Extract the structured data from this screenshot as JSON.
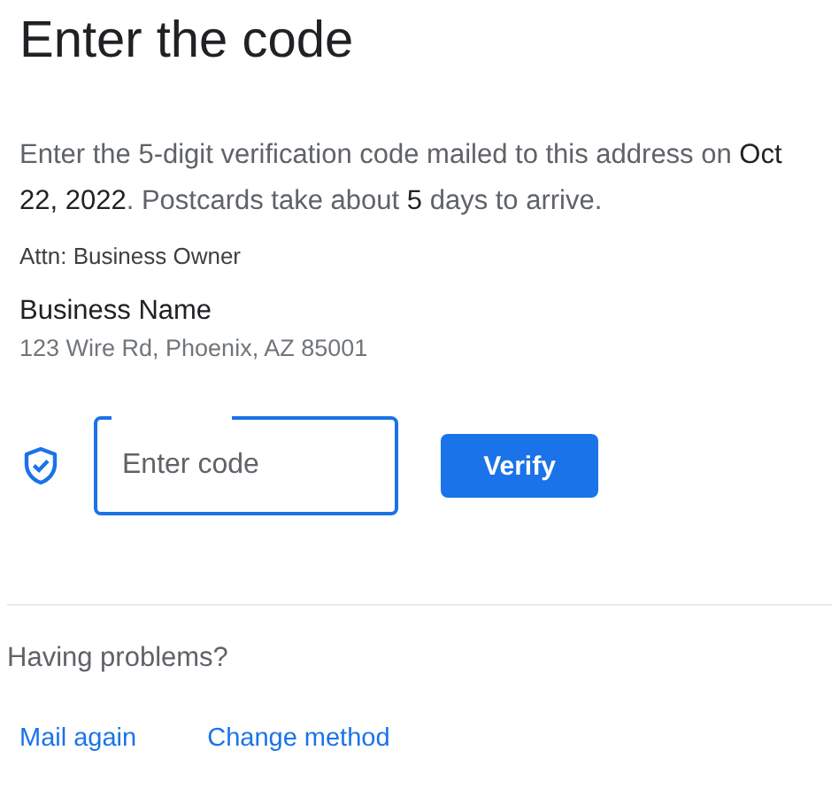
{
  "title": "Enter the code",
  "message": "Enter the 5-digit verification code mailed to this address on **Oct 22, 2022**. Postcards take about **5** days to arrive.",
  "attention": "Attn: Business Owner",
  "business": {
    "name": "Business Name",
    "address": "123 Wire Rd, Phoenix, AZ 85001"
  },
  "code_field": {
    "placeholder": "Enter code",
    "focused": true
  },
  "verify_button": "Verify",
  "help_heading": "Having problems?",
  "links": [
    "Mail again",
    "Change method"
  ]
}
